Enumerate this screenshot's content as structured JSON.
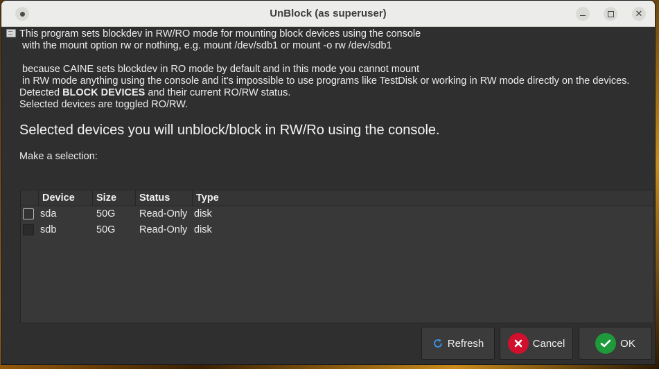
{
  "window": {
    "title": "UnBlock (as superuser)"
  },
  "info_lines": [
    "This program sets blockdev in RW/RO mode for mounting block devices using the console",
    " with the mount option rw or nothing, e.g. mount /dev/sdb1 or mount -o rw /dev/sdb1",
    "",
    " because CAINE sets blockdev in RO mode by default and in this mode you cannot mount",
    " in RW mode anything using the console and it's impossible to use programs like TestDisk or working in RW mode directly on the devices."
  ],
  "detected": {
    "prefix": "Detected ",
    "bold": "BLOCK DEVICES",
    "suffix": " and their current RO/RW status."
  },
  "toggle_note": "Selected devices are toggled RO/RW.",
  "heading": "Selected devices you will unblock/block in RW/Ro using the console.",
  "prompt": "Make a selection:",
  "table": {
    "headers": {
      "device": "Device",
      "size": "Size",
      "status": "Status",
      "type": "Type"
    },
    "rows": [
      {
        "device": "sda",
        "size": "50G",
        "status": "Read-Only",
        "type": "disk",
        "checked": false
      },
      {
        "device": "sdb",
        "size": "50G",
        "status": "Read-Only",
        "type": "disk",
        "checked": false
      }
    ]
  },
  "buttons": {
    "refresh": "Refresh",
    "cancel": "Cancel",
    "ok": "OK"
  },
  "icons": {
    "window_menu": "window-menu-icon",
    "minimize": "minimize-icon",
    "maximize": "maximize-icon",
    "close": "close-icon",
    "info": "document-icon",
    "refresh": "refresh-icon",
    "cancel": "cancel-icon",
    "ok": "checkmark-icon"
  },
  "colors": {
    "cancel_accent": "#d0102c",
    "ok_accent": "#1f9a3a",
    "refresh_accent": "#3b8fe0"
  }
}
